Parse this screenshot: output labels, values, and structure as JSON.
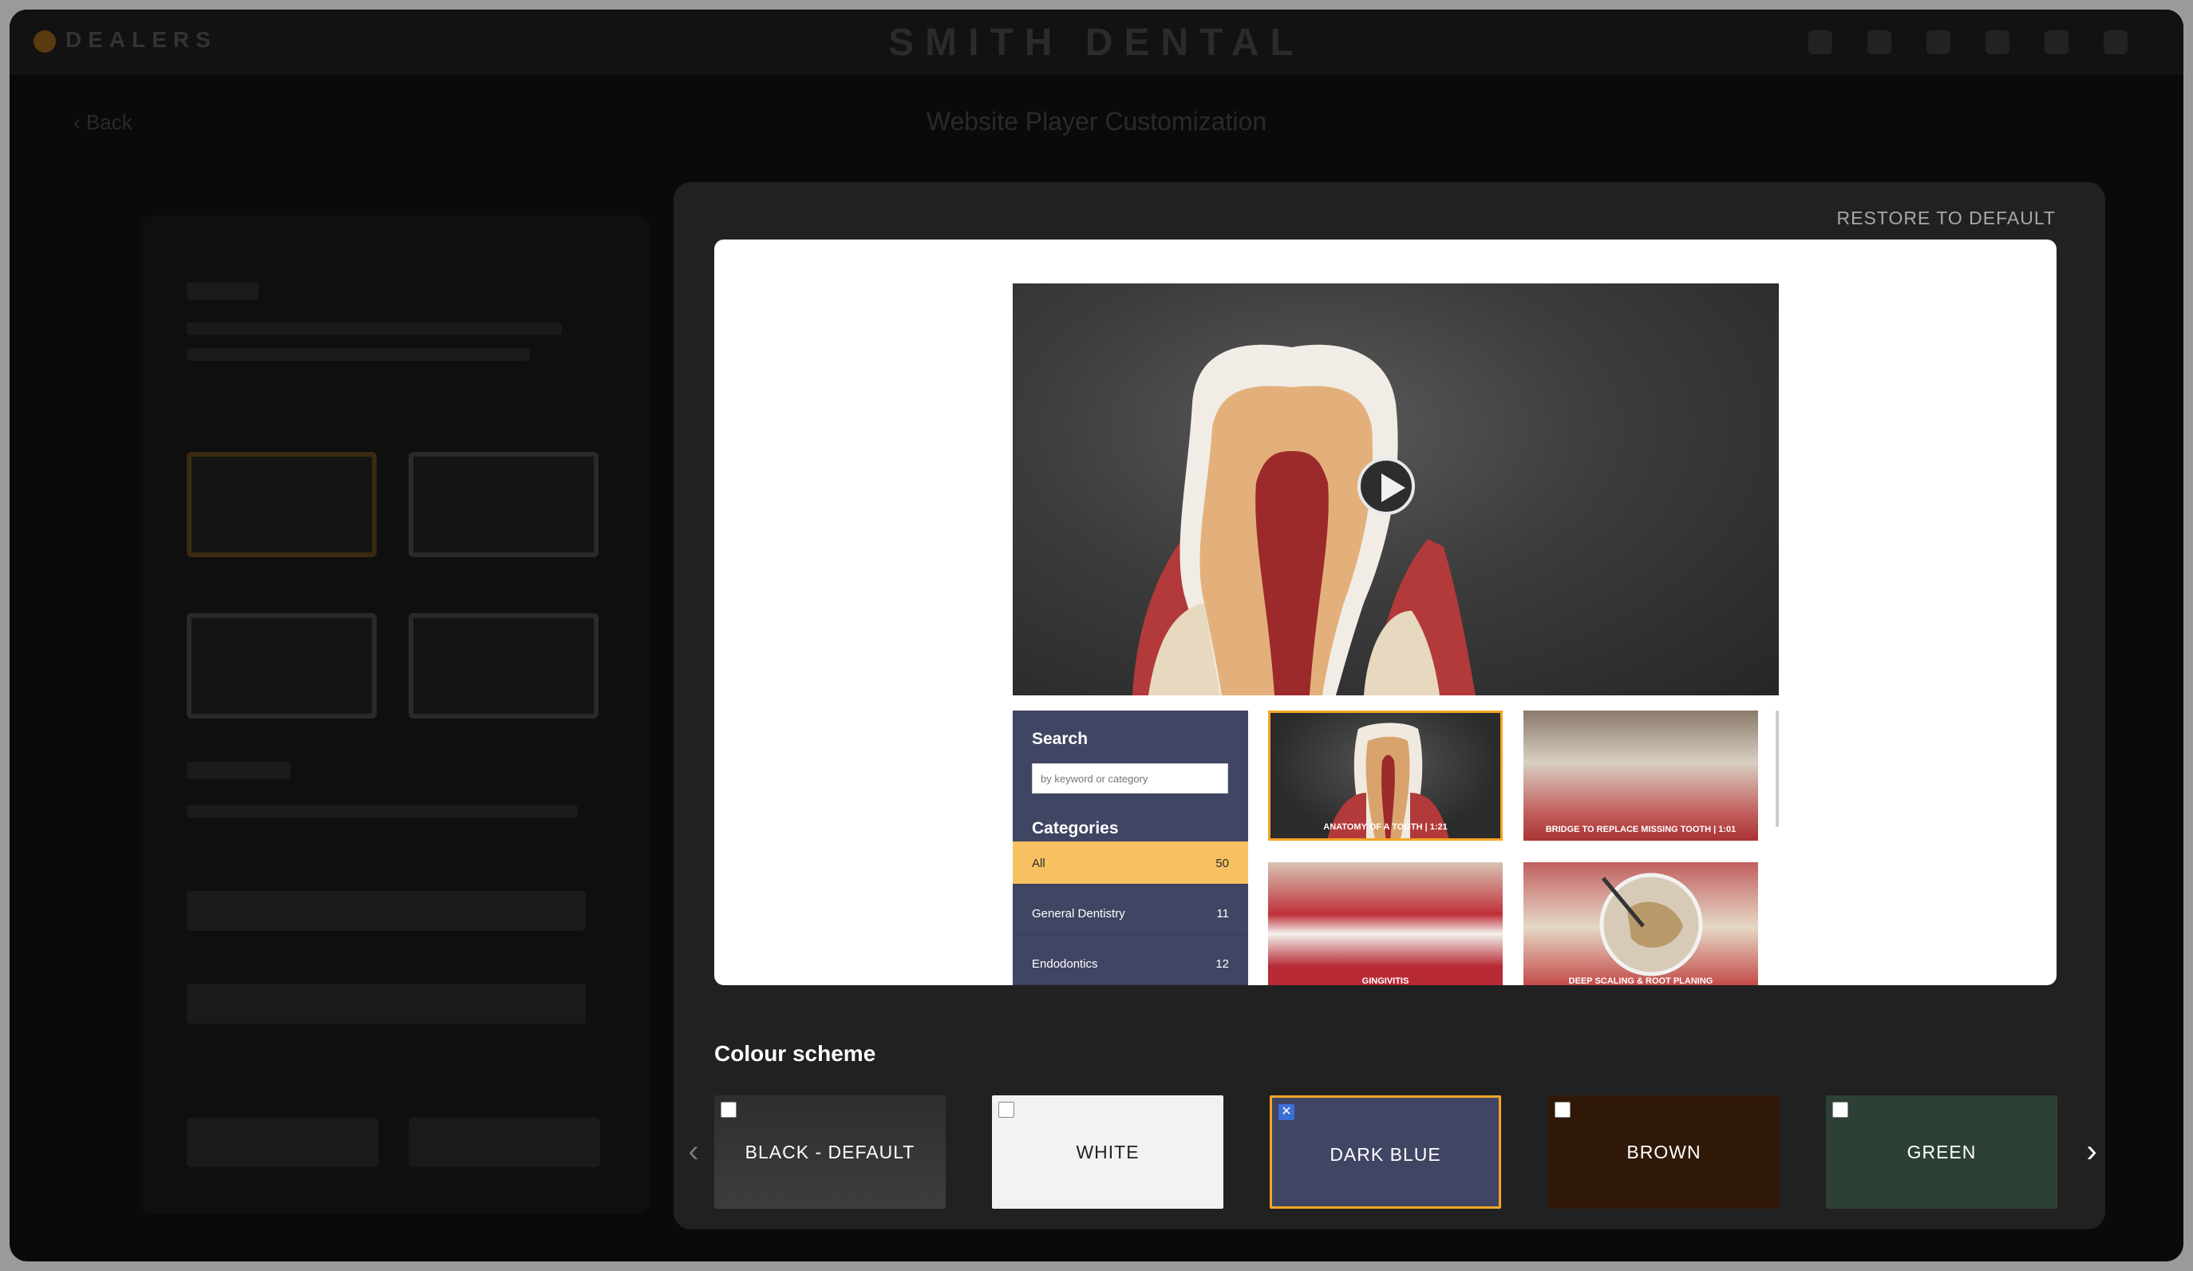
{
  "app": {
    "brand": "DEALERS",
    "site_title": "SMITH DENTAL",
    "back_label": "Back",
    "page_subtitle": "Website Player Customization"
  },
  "modal": {
    "restore_label": "RESTORE TO DEFAULT",
    "preview": {
      "search_heading": "Search",
      "search_placeholder": "by keyword or category",
      "categories_heading": "Categories",
      "categories": [
        {
          "label": "All",
          "count": "50",
          "active": true
        },
        {
          "label": "General Dentistry",
          "count": "11",
          "active": false
        },
        {
          "label": "Endodontics",
          "count": "12",
          "active": false
        }
      ],
      "videos": [
        {
          "caption": "ANATOMY OF A TOOTH  |  1:21"
        },
        {
          "caption": "BRIDGE TO REPLACE MISSING TOOTH |  1:01"
        },
        {
          "caption": "GINGIVITIS"
        },
        {
          "caption": "DEEP SCALING & ROOT PLANING"
        }
      ]
    },
    "colour_scheme": {
      "title": "Colour scheme",
      "options": [
        {
          "label": "BLACK - DEFAULT",
          "selected": false
        },
        {
          "label": "WHITE",
          "selected": false
        },
        {
          "label": "DARK BLUE",
          "selected": true
        },
        {
          "label": "BROWN",
          "selected": false
        },
        {
          "label": "GREEN",
          "selected": false
        }
      ],
      "prev_icon": "‹",
      "next_icon": "›"
    }
  },
  "colors": {
    "accent": "#f5a623",
    "dark_blue": "#404563",
    "brown": "#301808",
    "green": "#2d4035",
    "checkbox_on": "#3b6fd8"
  }
}
